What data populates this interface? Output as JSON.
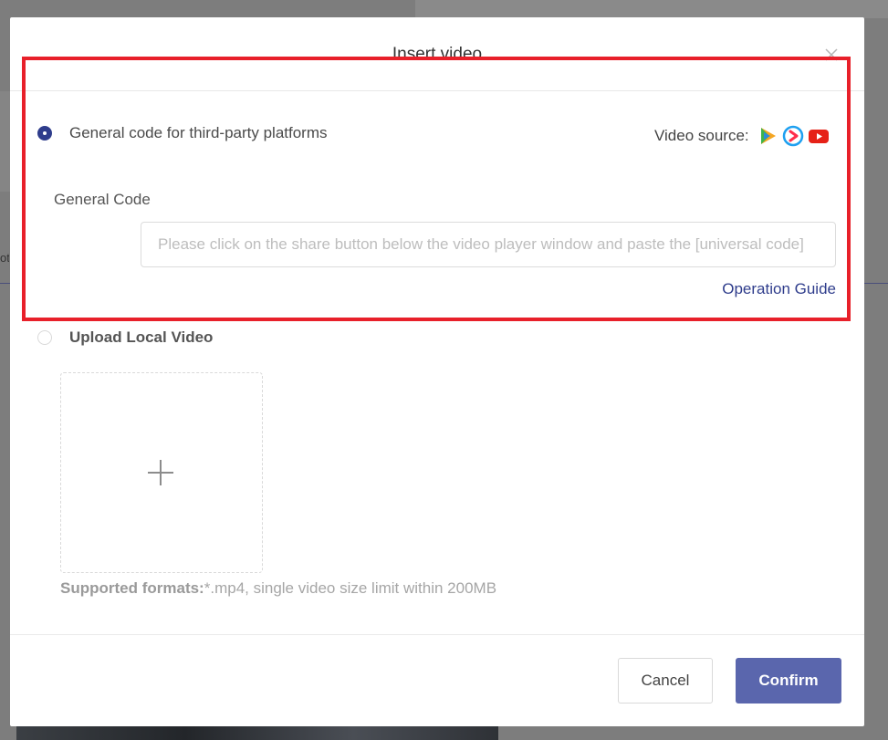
{
  "dialog": {
    "title": "Insert video",
    "close_icon": "close-icon"
  },
  "third_party": {
    "label": "General code for third-party platforms",
    "selected": true,
    "video_source_label": "Video source:",
    "source_icons": [
      "tencent-video-icon",
      "youku-icon",
      "youtube-icon"
    ],
    "field_label": "General Code",
    "input_value": "",
    "input_placeholder": "Please click on the share button below the video player window and paste the [universal code]",
    "guide_link": "Operation Guide"
  },
  "local_upload": {
    "label": "Upload Local Video",
    "selected": false,
    "add_icon": "plus-icon",
    "formats_label": "Supported formats:",
    "formats_text": "*.mp4, single video size limit within 200MB"
  },
  "footer": {
    "cancel_label": "Cancel",
    "confirm_label": "Confirm"
  },
  "colors": {
    "accent": "#2f3d8c",
    "confirm_bg": "#5a66ad",
    "highlight": "#e8202a",
    "overlay": "#7d7d7d"
  }
}
